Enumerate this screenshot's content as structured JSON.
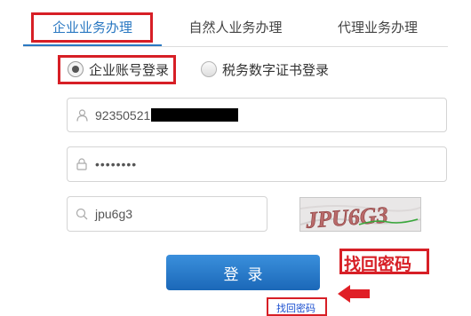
{
  "tabs": [
    {
      "label": "企业业务办理",
      "active": true
    },
    {
      "label": "自然人业务办理",
      "active": false
    },
    {
      "label": "代理业务办理",
      "active": false
    }
  ],
  "login_methods": [
    {
      "label": "企业账号登录",
      "selected": true
    },
    {
      "label": "税务数字证书登录",
      "selected": false
    }
  ],
  "fields": {
    "account": {
      "value": "92350521",
      "icon": "user-icon"
    },
    "password": {
      "value": "••••••••",
      "icon": "lock-icon"
    },
    "captcha_input": {
      "value": "jpu6g3",
      "icon": "search-icon"
    }
  },
  "captcha_image": {
    "text": "JPU6G3"
  },
  "login_button": {
    "label": "登录"
  },
  "forgot_password_link": {
    "label": "找回密码"
  },
  "annotation": {
    "label": "找回密码",
    "color": "#d71f26"
  },
  "colors": {
    "accent": "#2a78c2",
    "button": "#1b68b8",
    "highlight": "#d71f26"
  }
}
